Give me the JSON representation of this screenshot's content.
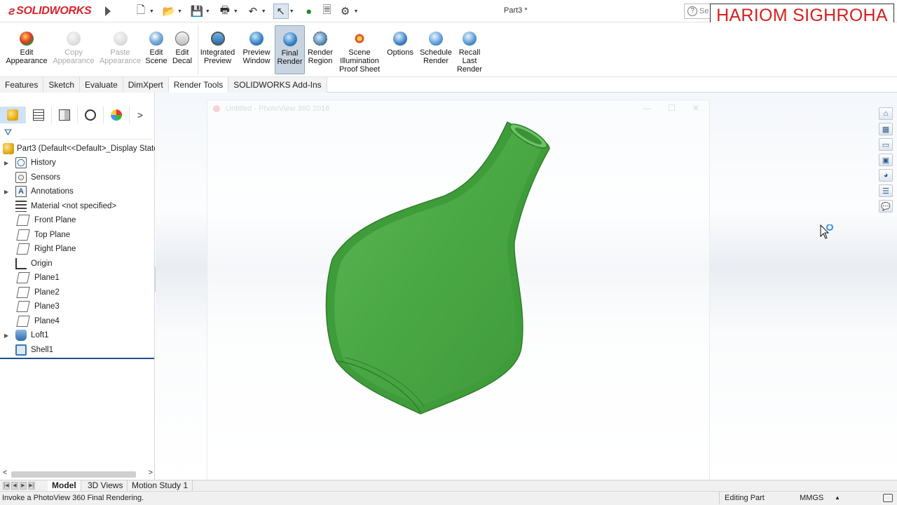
{
  "app": {
    "logo_text": "SOLIDWORKS",
    "document_title": "Part3 *",
    "search_placeholder": "Se",
    "help_glyph": "?",
    "watermark": "HARIOM SIGHROHA"
  },
  "quick_access": [
    {
      "name": "new-icon",
      "glyph": "🗋"
    },
    {
      "name": "open-icon",
      "glyph": "📂"
    },
    {
      "name": "save-icon",
      "glyph": "💾"
    },
    {
      "name": "print-icon",
      "glyph": "🖶"
    },
    {
      "name": "undo-icon",
      "glyph": "↶"
    },
    {
      "name": "select-icon",
      "glyph": "↖"
    },
    {
      "name": "rebuild-icon",
      "glyph": "🚦"
    },
    {
      "name": "file-properties-icon",
      "glyph": "🗏"
    },
    {
      "name": "options-icon",
      "glyph": "⚙"
    }
  ],
  "ribbon": {
    "edit_appearance": "Edit Appearance",
    "copy_appearance": "Copy Appearance",
    "paste_appearance": "Paste Appearance",
    "edit_scene": "Edit Scene",
    "edit_decal": "Edit Decal",
    "integrated_preview": "Integrated Preview",
    "preview_window": "Preview Window",
    "final_render": "Final Render",
    "render_region": "Render Region",
    "scene_illumination": "Scene Illumination Proof Sheet",
    "options": "Options",
    "schedule_render": "Schedule Render",
    "recall_last_render": "Recall Last Render"
  },
  "tabs": [
    "Features",
    "Sketch",
    "Evaluate",
    "DimXpert",
    "Render Tools",
    "SOLIDWORKS Add-Ins"
  ],
  "active_tab": "Render Tools",
  "panel": {
    "next_glyph": ">"
  },
  "tree": {
    "root": "Part3  (Default<<Default>_Display State",
    "items": [
      {
        "label": "History",
        "expandable": true
      },
      {
        "label": "Sensors",
        "expandable": false
      },
      {
        "label": "Annotations",
        "expandable": true
      },
      {
        "label": "Material <not specified>",
        "expandable": false
      },
      {
        "label": "Front Plane",
        "expandable": false
      },
      {
        "label": "Top Plane",
        "expandable": false
      },
      {
        "label": "Right Plane",
        "expandable": false
      },
      {
        "label": "Origin",
        "expandable": false
      },
      {
        "label": "Plane1",
        "expandable": false
      },
      {
        "label": "Plane2",
        "expandable": false
      },
      {
        "label": "Plane3",
        "expandable": false
      },
      {
        "label": "Plane4",
        "expandable": false
      },
      {
        "label": "Loft1",
        "expandable": true
      },
      {
        "label": "Shell1",
        "expandable": false
      }
    ]
  },
  "photoview": {
    "title": "Untitled - PhotoView 360 2016"
  },
  "bottom_tabs": [
    "Model",
    "3D Views",
    "Motion Study 1"
  ],
  "active_bottom_tab": "Model",
  "status": {
    "message": "Invoke a PhotoView 360 Final Rendering.",
    "mode": "Editing Part",
    "units": "MMGS"
  },
  "colors": {
    "vase_green": "#4cae46",
    "logo_red": "#d8232a",
    "watermark_red": "#d62020"
  }
}
